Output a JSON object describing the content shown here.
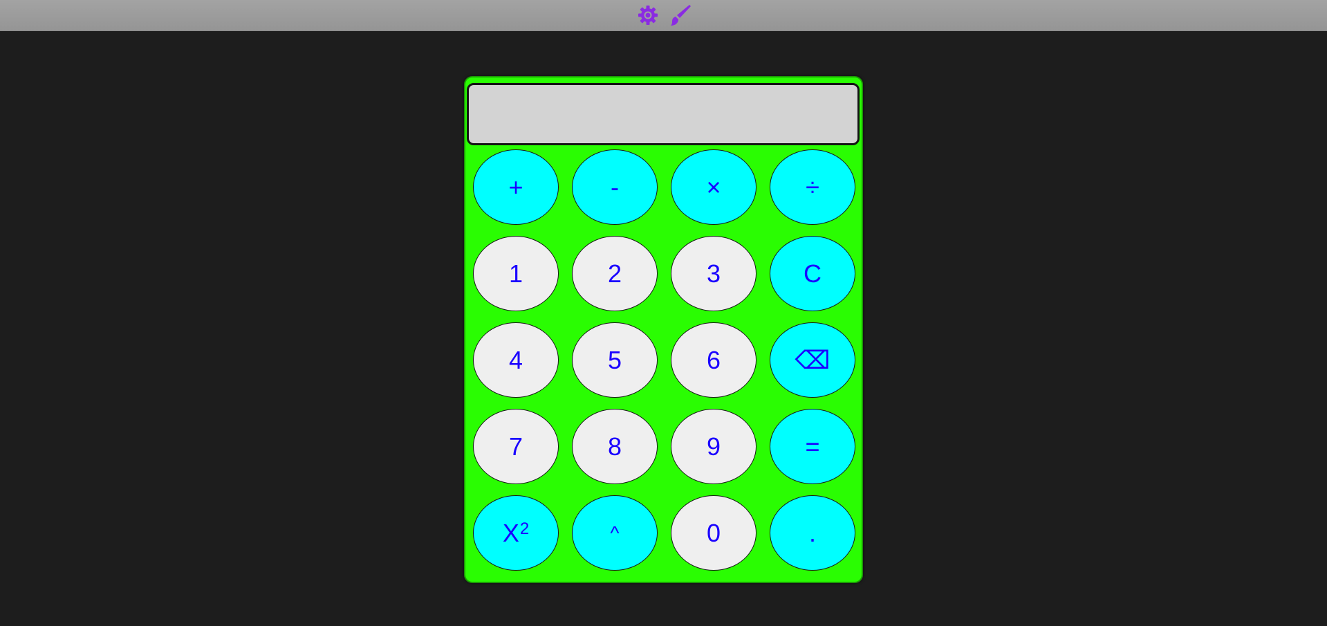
{
  "topbar": {
    "icons": [
      "gear-icon",
      "paintbrush-icon"
    ],
    "accent_color": "#8a2be2"
  },
  "calculator": {
    "body_color": "#2afd02",
    "operator_key_color": "#00ffff",
    "number_key_color": "#efefef",
    "key_text_color": "#1a00ff",
    "display_value": "",
    "keys": {
      "plus": "+",
      "minus": "-",
      "multiply": "×",
      "divide": "÷",
      "one": "1",
      "two": "2",
      "three": "3",
      "clear": "C",
      "four": "4",
      "five": "5",
      "six": "6",
      "backspace": "⌫",
      "seven": "7",
      "eight": "8",
      "nine": "9",
      "equals": "=",
      "square_base": "X",
      "square_exp": "2",
      "power": "^",
      "zero": "0",
      "decimal": "."
    }
  }
}
